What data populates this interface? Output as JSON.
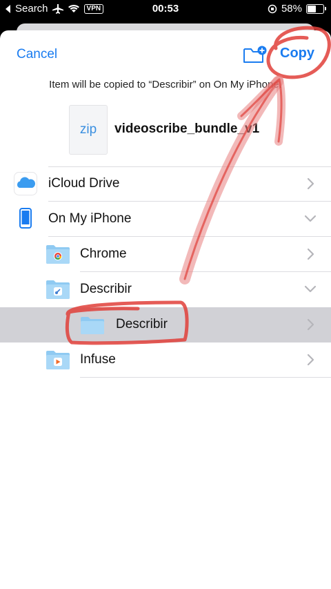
{
  "status_bar": {
    "back_app": "Search",
    "time": "00:53",
    "vpn": "VPN",
    "battery": "58%",
    "battery_level": 0.58
  },
  "nav": {
    "cancel": "Cancel",
    "copy": "Copy"
  },
  "subtitle": "Item will be copied to “Describir” on On My iPhone.",
  "file": {
    "thumb_label": "zip",
    "name": "videoscribe_bundle_v1"
  },
  "locations": [
    {
      "label": "iCloud Drive",
      "icon": "icloud-icon",
      "chevron": "right"
    },
    {
      "label": "On My iPhone",
      "icon": "iphone-icon",
      "chevron": "down"
    },
    {
      "label": "Chrome",
      "icon": "chrome-folder-icon",
      "chevron": "right"
    },
    {
      "label": "Describir",
      "icon": "describir-folder-icon",
      "chevron": "down"
    },
    {
      "label": "Describir",
      "icon": "folder-icon",
      "chevron": "right",
      "selected": true
    },
    {
      "label": "Infuse",
      "icon": "infuse-folder-icon",
      "chevron": "right"
    }
  ],
  "colors": {
    "accent": "#1a7cf0",
    "selected_row": "#d1d1d6",
    "annotation": "#e0403a"
  }
}
